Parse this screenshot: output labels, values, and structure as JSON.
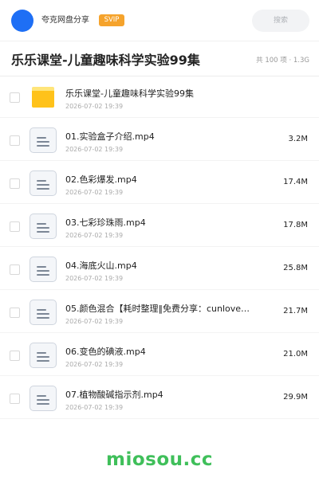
{
  "header": {
    "user_name": "夸克网盘分享",
    "badge": "SVIP",
    "search_placeholder": "搜索",
    "avatar_color": "#1e6ff5",
    "badge_color": "#f5a32c"
  },
  "folder_title": "乐乐课堂-儿童趣味科学实验99集",
  "summary": "共 100 项 · 1.3G",
  "files": [
    {
      "type": "folder",
      "icon": "folder-icon",
      "name": "乐乐课堂-儿童趣味科学实验99集",
      "date": "2026-07-02 19:39",
      "size": ""
    },
    {
      "type": "file",
      "icon": "document-icon",
      "name": "01.实验盒子介绍.mp4",
      "date": "2026-07-02 19:39",
      "size": "3.2M"
    },
    {
      "type": "file",
      "icon": "document-icon",
      "name": "02.色彩爆发.mp4",
      "date": "2026-07-02 19:39",
      "size": "17.4M"
    },
    {
      "type": "file",
      "icon": "document-icon",
      "name": "03.七彩珍珠雨.mp4",
      "date": "2026-07-02 19:39",
      "size": "17.8M"
    },
    {
      "type": "file",
      "icon": "document-icon",
      "name": "04.海底火山.mp4",
      "date": "2026-07-02 19:39",
      "size": "25.8M"
    },
    {
      "type": "file",
      "icon": "document-icon",
      "name": "05.颜色混合【耗时整理‖免费分享：cunlove…",
      "date": "2026-07-02 19:39",
      "size": "21.7M"
    },
    {
      "type": "file",
      "icon": "document-icon",
      "name": "06.变色的碘液.mp4",
      "date": "2026-07-02 19:39",
      "size": "21.0M"
    },
    {
      "type": "file",
      "icon": "document-icon",
      "name": "07.植物酸碱指示剂.mp4",
      "date": "2026-07-02 19:39",
      "size": "29.9M"
    }
  ],
  "watermark": "miosou.cc",
  "colors": {
    "folder": "#ffc21a",
    "watermark": "#3fbf5a"
  }
}
